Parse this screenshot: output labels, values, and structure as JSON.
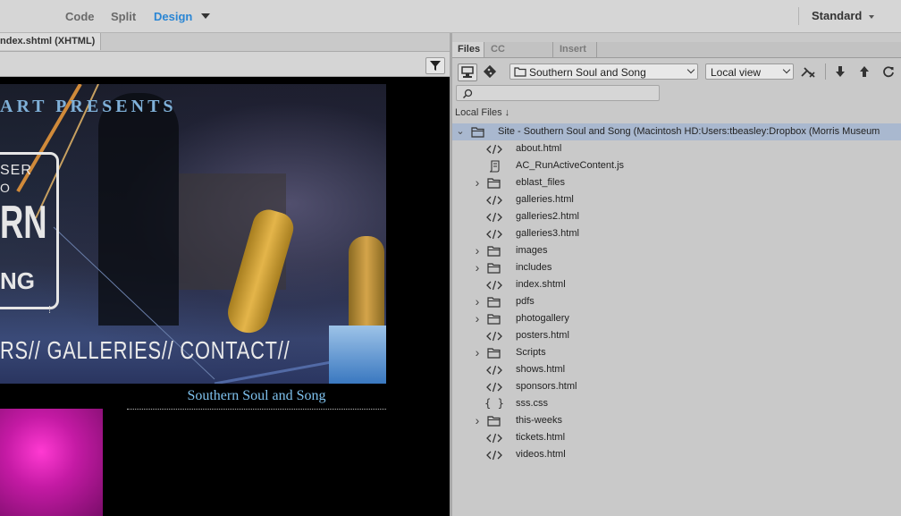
{
  "toolbar": {
    "modes": [
      "Code",
      "Split",
      "Design"
    ],
    "active_mode": "Design",
    "workspace": "Standard"
  },
  "document": {
    "tab_title": "ndex.shtml (XHTML)",
    "banner": {
      "presents": "ART PRESENTS",
      "logo_line1": "SER",
      "logo_line2": "O",
      "logo_big": "RN",
      "logo_bottom": "NG",
      "nav": "RS// GALLERIES// CONTACT//"
    },
    "heading": "Southern Soul and Song"
  },
  "panel": {
    "tabs": [
      "Files",
      "CC Libraries",
      "Insert"
    ],
    "active_tab": "Files",
    "site_select": "Southern Soul and Song",
    "view_select": "Local view",
    "local_files_label": "Local Files",
    "sort_arrow": "↓",
    "site_root": "Site - Southern Soul and Song (Macintosh HD:Users:tbeasley:Dropbox (Morris Museum",
    "files": [
      {
        "name": "about.html",
        "type": "code",
        "expandable": false
      },
      {
        "name": "AC_RunActiveContent.js",
        "type": "script",
        "expandable": false
      },
      {
        "name": "eblast_files",
        "type": "folder",
        "expandable": true
      },
      {
        "name": "galleries.html",
        "type": "code",
        "expandable": false
      },
      {
        "name": "galleries2.html",
        "type": "code",
        "expandable": false
      },
      {
        "name": "galleries3.html",
        "type": "code",
        "expandable": false
      },
      {
        "name": "images",
        "type": "folder",
        "expandable": true
      },
      {
        "name": "includes",
        "type": "folder",
        "expandable": true
      },
      {
        "name": "index.shtml",
        "type": "code",
        "expandable": false
      },
      {
        "name": "pdfs",
        "type": "folder",
        "expandable": true
      },
      {
        "name": "photogallery",
        "type": "folder",
        "expandable": true
      },
      {
        "name": "posters.html",
        "type": "code",
        "expandable": false
      },
      {
        "name": "Scripts",
        "type": "folder",
        "expandable": true
      },
      {
        "name": "shows.html",
        "type": "code",
        "expandable": false
      },
      {
        "name": "sponsors.html",
        "type": "code",
        "expandable": false
      },
      {
        "name": "sss.css",
        "type": "css",
        "expandable": false
      },
      {
        "name": "this-weeks",
        "type": "folder",
        "expandable": true
      },
      {
        "name": "tickets.html",
        "type": "code",
        "expandable": false
      },
      {
        "name": "videos.html",
        "type": "code",
        "expandable": false
      }
    ]
  },
  "colors": {
    "accent": "#2b86d4",
    "selection": "#a9b8cf",
    "heading_text": "#7fc2ee"
  }
}
